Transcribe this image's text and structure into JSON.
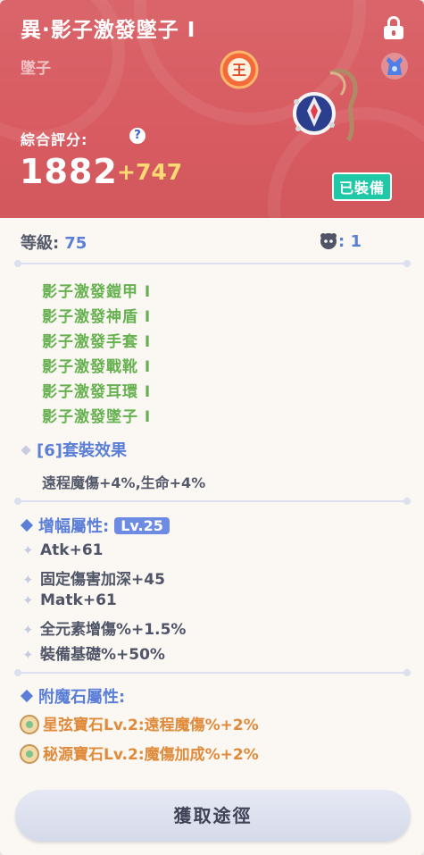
{
  "item": {
    "name": "異·影子激發墜子 Ⅰ",
    "type": "墜子",
    "score_label": "綜合評分:",
    "score": "1882",
    "score_bonus": "+747",
    "equipped_label": "已裝備"
  },
  "level": {
    "label": "等級:",
    "value": "75",
    "coop_value": ": 1"
  },
  "set": {
    "items": [
      "影子激發鎧甲 Ⅰ",
      "影子激發神盾 Ⅰ",
      "影子激發手套 Ⅰ",
      "影子激發戰靴 Ⅰ",
      "影子激發耳環 Ⅰ",
      "影子激發墜子 Ⅰ"
    ],
    "effect_title": "[6]套裝效果",
    "effect_text": "遠程魔傷+4%,生命+4%"
  },
  "amplify": {
    "title": "增幅屬性:",
    "level_badge": "Lv.25",
    "attrs": [
      "Atk+61",
      "固定傷害加深+45",
      "Matk+61",
      "全元素增傷%+1.5%",
      "裝備基礎%+50%"
    ]
  },
  "enchant": {
    "title": "附魔石屬性:",
    "gems": [
      "星弦寶石Lv.2:遠程魔傷%+2%",
      "秘源寶石Lv.2:魔傷加成%+2%"
    ]
  },
  "acquire_button": "獲取途徑",
  "icons": {
    "lock": "lock-icon",
    "slot": "necklace-slot-icon",
    "badge": "king-badge-icon",
    "help": "help-icon",
    "coop": "coop-icon",
    "gem": "gem-icon"
  },
  "colors": {
    "header": "#d85b61",
    "set_green": "#66b14f",
    "accent_blue": "#5b7fd7",
    "gem_orange": "#e08a3a",
    "equipped": "#1fc8a6",
    "bonus_gold": "#ffd974"
  }
}
